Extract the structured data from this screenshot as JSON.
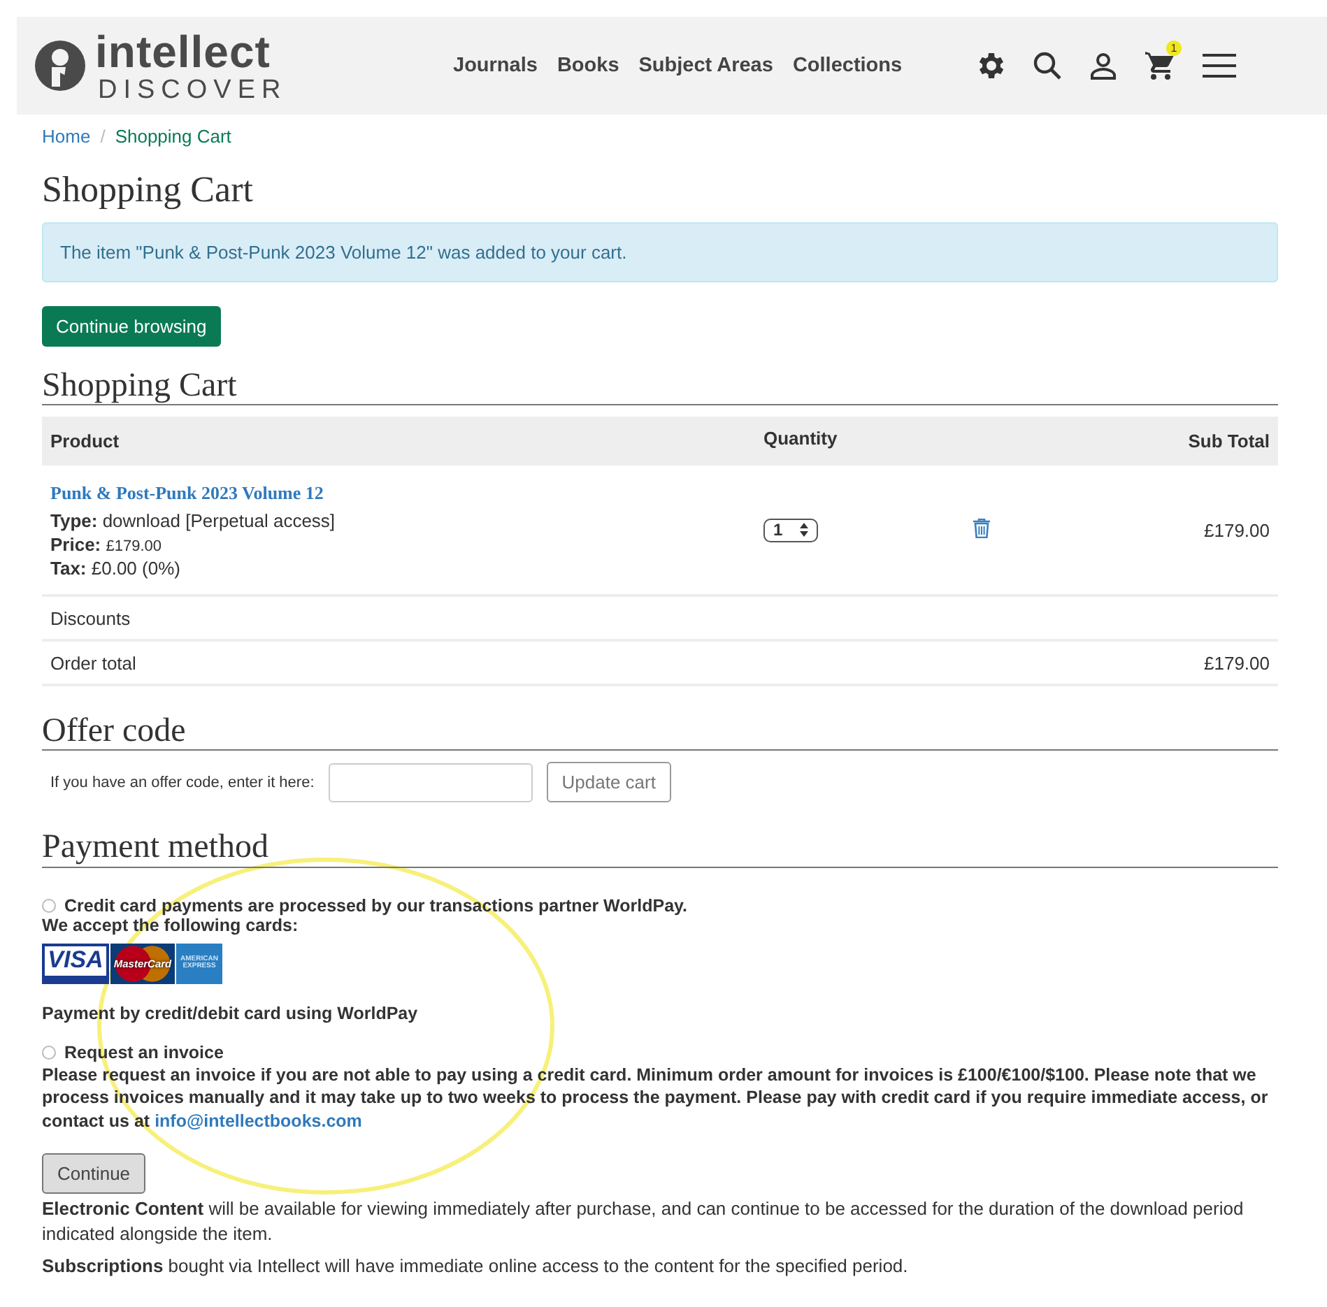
{
  "header": {
    "logo_top": "intellect",
    "logo_bottom": "DISCOVER",
    "nav": [
      "Journals",
      "Books",
      "Subject Areas",
      "Collections"
    ],
    "cart_count": "1"
  },
  "breadcrumb_separator": "/",
  "breadcrumb": [
    {
      "label": "Home",
      "current": false
    },
    {
      "label": "Shopping Cart",
      "current": true
    }
  ],
  "title": "Shopping Cart",
  "alert": "The item \"Punk & Post-Punk 2023 Volume 12\" was added to your cart.",
  "continue_browsing": "Continue browsing",
  "cart": {
    "heading": "Shopping Cart",
    "columns": [
      "Product",
      "Quantity",
      "Sub Total"
    ],
    "items": [
      {
        "name": "Punk & Post-Punk 2023 Volume 12",
        "type_label": "Type:",
        "type": "download [Perpetual access]",
        "price_label": "Price:",
        "price": "£179.00",
        "tax_label": "Tax:",
        "tax": "£0.00 (0%)",
        "quantity": "1",
        "subtotal": "£179.00"
      }
    ],
    "discounts": "Discounts",
    "order_total_label": "Order total",
    "order_total": "£179.00"
  },
  "offer": {
    "heading": "Offer code",
    "label": "If you have an offer code, enter it here:",
    "button": "Update cart"
  },
  "payment": {
    "heading": "Payment method",
    "options": [
      {
        "kind": "card",
        "label": "Credit card payments are processed by our transactions partner WorldPay.",
        "selected": false,
        "accept": "We accept the following cards:",
        "cards": [
          "VISA",
          "MasterCard",
          "AMERICAN EXPRESS"
        ],
        "note": "Payment by credit/debit card using WorldPay"
      },
      {
        "kind": "invoice",
        "label": "Request an invoice",
        "selected": false,
        "text": "Please request an invoice if you are not able to pay using a credit card. Minimum order amount for invoices is £100/€100/$100. Please note that we process invoices manually and it may take up to two weeks to process the payment. Please pay with credit card if you require immediate access, or contact us at",
        "email": "info@intellectbooks.com"
      }
    ]
  },
  "continue": "Continue",
  "notes": [
    "**Electronic Content** will be available for viewing immediately after purchase, and can continue to be accessed for the duration of the download period indicated alongside the item.",
    "**Subscriptions** bought via Intellect will have immediate online access to the content for the specified period."
  ],
  "annotation": {
    "kind": "ellipse"
  }
}
